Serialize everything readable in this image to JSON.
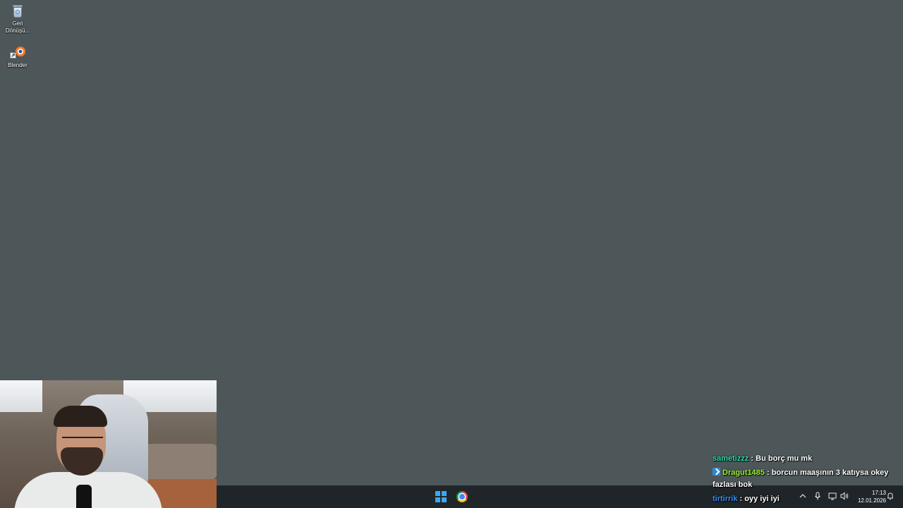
{
  "desktop": {
    "background_color": "#4d5759",
    "icons": [
      {
        "label": "Geri Dönüşü...",
        "icon": "recycle-bin-icon"
      },
      {
        "label": "Blender",
        "icon": "blender-icon"
      }
    ]
  },
  "webcam": {
    "description_icon": "webcam-feed"
  },
  "taskbar": {
    "apps": [
      {
        "name": "start",
        "icon": "windows-logo-icon",
        "accent": "#3aa8f5"
      },
      {
        "name": "chrome",
        "icon": "chrome-icon"
      }
    ],
    "tray": {
      "icons": [
        "chevron-up-icon",
        "microphone-icon",
        "network-icon",
        "volume-icon",
        "notification-icon"
      ],
      "time": "17:13",
      "date": "12.01.2026"
    }
  },
  "chat": {
    "messages": [
      {
        "user": "sametizzz",
        "user_color": "#2fd8a8",
        "separator": " : ",
        "text": "Bu borç mu mk",
        "badge": false
      },
      {
        "user": "Dragut1485",
        "user_color": "#9af23a",
        "separator": " : ",
        "text": "borcun maaşının 3 katıysa okey fazlası bok",
        "badge": true
      },
      {
        "user": "tirtirrik",
        "user_color": "#3d8ef0",
        "separator": " : ",
        "text": "oyy iyi iyi",
        "badge": false
      }
    ]
  }
}
